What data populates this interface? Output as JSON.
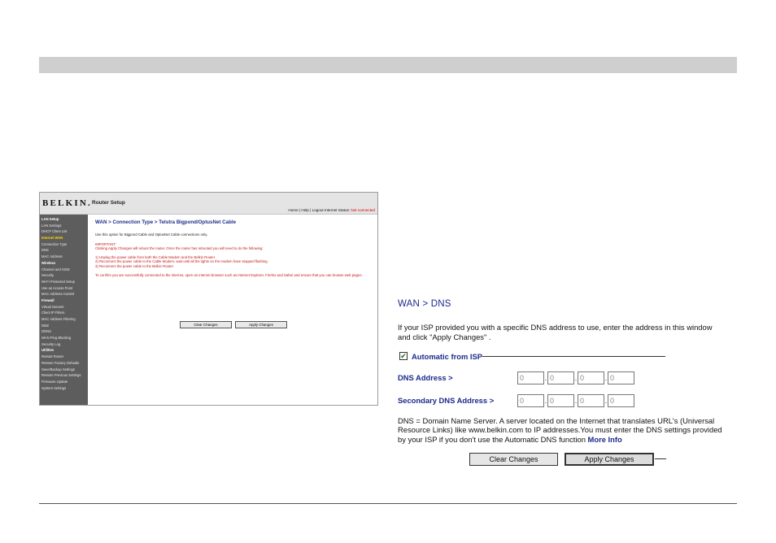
{
  "router": {
    "brand": "BELKIN.",
    "title": "Router Setup",
    "header_links": "Home | Help | Logout   Internet Status:",
    "status": "Not connected",
    "sidebar": [
      {
        "label": "LAN Setup",
        "kind": "section"
      },
      {
        "label": "LAN Settings",
        "kind": "item"
      },
      {
        "label": "DHCP Client List",
        "kind": "item"
      },
      {
        "label": "Internet WAN",
        "kind": "active"
      },
      {
        "label": "Connection Type",
        "kind": "item"
      },
      {
        "label": "DNS",
        "kind": "item"
      },
      {
        "label": "MAC Address",
        "kind": "item"
      },
      {
        "label": "Wireless",
        "kind": "section"
      },
      {
        "label": "Channel and SSID",
        "kind": "item"
      },
      {
        "label": "Security",
        "kind": "item"
      },
      {
        "label": "Wi-Fi Protected Setup",
        "kind": "item"
      },
      {
        "label": "Use as Access Point",
        "kind": "item"
      },
      {
        "label": "MAC Address Control",
        "kind": "item"
      },
      {
        "label": "Firewall",
        "kind": "section"
      },
      {
        "label": "Virtual Servers",
        "kind": "item"
      },
      {
        "label": "Client IP Filters",
        "kind": "item"
      },
      {
        "label": "MAC Address Filtering",
        "kind": "item"
      },
      {
        "label": "DMZ",
        "kind": "item"
      },
      {
        "label": "DDNS",
        "kind": "item"
      },
      {
        "label": "WAN Ping Blocking",
        "kind": "item"
      },
      {
        "label": "Security Log",
        "kind": "item"
      },
      {
        "label": "Utilities",
        "kind": "section"
      },
      {
        "label": "Restart Router",
        "kind": "item"
      },
      {
        "label": "Restore Factory Defaults",
        "kind": "item"
      },
      {
        "label": "Save/Backup Settings",
        "kind": "item"
      },
      {
        "label": "Restore Previous Settings",
        "kind": "item"
      },
      {
        "label": "Firmware Update",
        "kind": "item"
      },
      {
        "label": "System Settings",
        "kind": "item"
      }
    ],
    "content": {
      "heading": "WAN > Connection Type > Telstra Bigpond/OptusNet Cable",
      "intro": "Use this option for Bigpond Cable and OptusNet Cable connections only.",
      "important": "IMPORTANT:",
      "warning": "Clicking Apply Changes will reboot the router. Once the router has rebooted you will need to do the following:",
      "step1": "1) Unplug the power cable from both the Cable Modem and the Belkin Router",
      "step2": "2) Reconnect the power cable to the Cable Modem, wait until all the lights on the modem have stopped flashing",
      "step3": "3) Reconnect the power cable to the Belkin Router",
      "confirm": "To confirm you are successfully connected to the internet, open an internet browser such as Internet Explorer, Firefox and Safari and ensure that you can browse web pages.",
      "clear_label": "Clear Changes",
      "apply_label": "Apply Changes"
    }
  },
  "dns": {
    "title": "WAN > DNS",
    "description": "If your ISP provided you with a specific DNS address to use, enter the address in this window and click \"Apply Changes\" .",
    "auto_label": "Automatic from ISP",
    "auto_checked": true,
    "dns_label": "DNS Address >",
    "secondary_label": "Secondary DNS Address >",
    "dns_octets": [
      "0",
      "0",
      "0",
      "0"
    ],
    "secondary_octets": [
      "0",
      "0",
      "0",
      "0"
    ],
    "note": "DNS = Domain Name Server. A server located on the Internet that translates URL's (Universal Resource Links) like www.belkin.com to IP addresses.You must enter the DNS settings provided by your ISP if you don't use the Automatic DNS function",
    "more_info": "More Info",
    "clear_label": "Clear Changes",
    "apply_label": "Apply Changes"
  }
}
